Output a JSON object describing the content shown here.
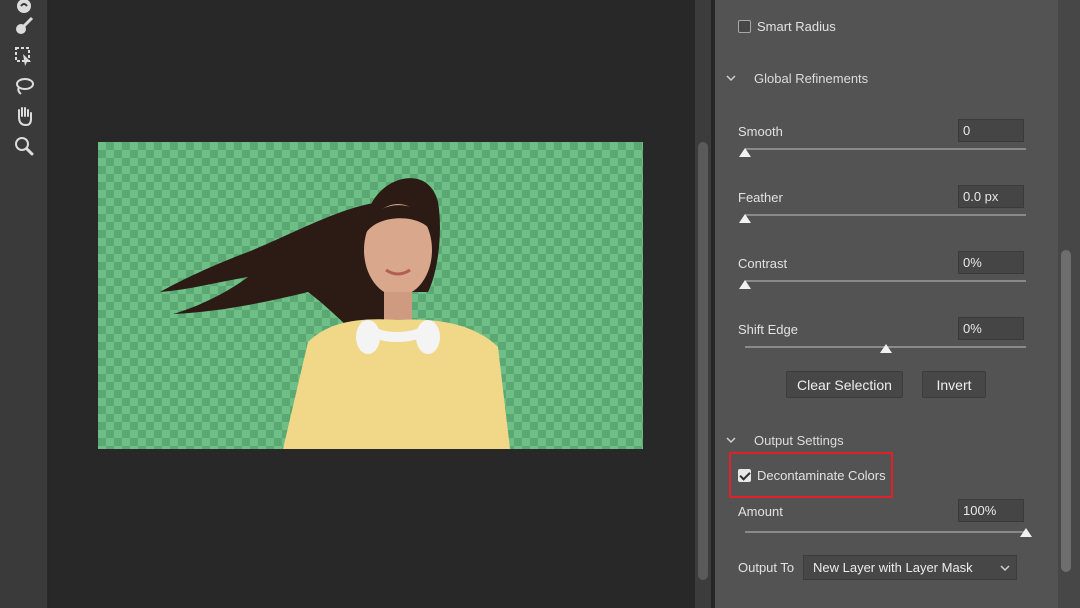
{
  "toolbar": {
    "tools": [
      {
        "icon": "quick-selection-icon"
      },
      {
        "icon": "refine-edge-brush-icon"
      },
      {
        "icon": "object-selection-icon"
      },
      {
        "icon": "lasso-icon"
      },
      {
        "icon": "hand-icon"
      },
      {
        "icon": "zoom-icon"
      }
    ]
  },
  "panel": {
    "smart_radius": {
      "label": "Smart Radius",
      "checked": false
    },
    "global_refinements": {
      "title": "Global Refinements",
      "smooth": {
        "label": "Smooth",
        "value": "0",
        "level": 0
      },
      "feather": {
        "label": "Feather",
        "value": "0.0 px",
        "level": 0
      },
      "contrast": {
        "label": "Contrast",
        "value": "0%",
        "level": 0
      },
      "shift_edge": {
        "label": "Shift Edge",
        "value": "0%",
        "level": 0.5
      }
    },
    "buttons": {
      "clear_selection": "Clear Selection",
      "invert": "Invert"
    },
    "output_settings": {
      "title": "Output Settings",
      "decontaminate": {
        "label": "Decontaminate Colors",
        "checked": true
      },
      "amount": {
        "label": "Amount",
        "value": "100%",
        "level": 1
      },
      "output_to": {
        "label": "Output To",
        "value": "New Layer with Layer Mask"
      }
    }
  },
  "colors": {
    "highlight": "#e2202c",
    "checker_light": "#6dbf85",
    "checker_dark": "#5ca874"
  }
}
